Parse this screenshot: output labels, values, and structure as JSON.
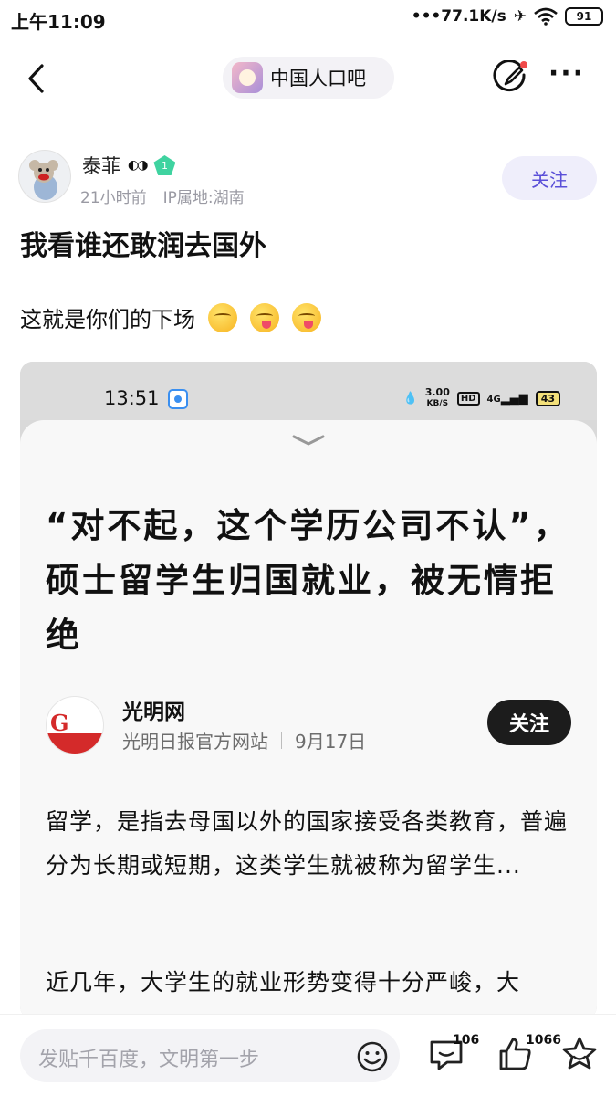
{
  "status_bar": {
    "time": "上午11:09",
    "speed": "•••77.1K/s",
    "battery": "91"
  },
  "nav": {
    "forum_name": "中国人口吧"
  },
  "author": {
    "name": "泰菲",
    "level": "1",
    "time_ago": "21小时前",
    "ip_location": "IP属地:湖南",
    "follow_label": "关注"
  },
  "post": {
    "title": "我看谁还敢润去国外",
    "body": "这就是你们的下场",
    "emojis": [
      "grin-emoji",
      "tongue-emoji",
      "tongue-emoji"
    ]
  },
  "screenshot": {
    "time": "13:51",
    "speed_top": "3.00",
    "speed_unit": "KB/S",
    "hd": "HD",
    "network": "4G",
    "battery": "43",
    "article_title": "“对不起，这个学历公司不认”，硕士留学生归国就业，被无情拒绝",
    "publisher_name": "光明网",
    "publisher_desc": "光明日报官方网站",
    "publish_date": "9月17日",
    "follow_label": "关注",
    "paragraph1": "留学，是指去母国以外的国家接受各类教育，普遍分为长期或短期，这类学生就被称为留学生...",
    "paragraph2": "近几年，大学生的就业形势变得十分严峻，大"
  },
  "bottom_bar": {
    "input_placeholder": "发贴千百度，文明第一步",
    "comment_count": "106",
    "like_count": "1066"
  }
}
